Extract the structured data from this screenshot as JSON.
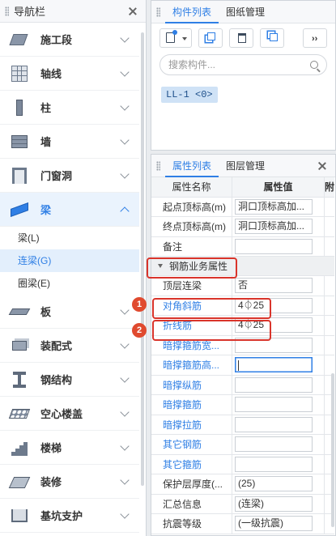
{
  "nav": {
    "title": "导航栏",
    "items": [
      {
        "label": "施工段",
        "icon": "construction-segment-icon"
      },
      {
        "label": "轴线",
        "icon": "axis-grid-icon"
      },
      {
        "label": "柱",
        "icon": "column-icon"
      },
      {
        "label": "墙",
        "icon": "wall-icon"
      },
      {
        "label": "门窗洞",
        "icon": "door-window-icon"
      },
      {
        "label": "梁",
        "icon": "beam-icon",
        "expanded": true
      },
      {
        "label": "板",
        "icon": "slab-icon"
      },
      {
        "label": "装配式",
        "icon": "prefab-icon"
      },
      {
        "label": "钢结构",
        "icon": "steel-structure-icon"
      },
      {
        "label": "空心楼盖",
        "icon": "hollow-floor-icon"
      },
      {
        "label": "楼梯",
        "icon": "stair-icon"
      },
      {
        "label": "装修",
        "icon": "decoration-icon"
      },
      {
        "label": "基坑支护",
        "icon": "foundation-pit-icon"
      }
    ],
    "beam_sub": [
      "梁(L)",
      "连梁(G)",
      "圈梁(E)"
    ],
    "beam_sub_selected": "连梁(G)"
  },
  "component_panel": {
    "tabs": [
      "构件列表",
      "图纸管理"
    ],
    "active_tab": "构件列表",
    "search_placeholder": "搜索构件...",
    "item": "LL-1 <0>"
  },
  "property_panel": {
    "tabs": [
      "属性列表",
      "图层管理"
    ],
    "active_tab": "属性列表",
    "col_name": "属性名称",
    "col_value": "属性值",
    "col_extra": "附",
    "rows_top": [
      {
        "name": "起点顶标高(m)",
        "value": "洞口顶标高加..."
      },
      {
        "name": "终点顶标高(m)",
        "value": "洞口顶标高加..."
      },
      {
        "name": "备注",
        "value": ""
      }
    ],
    "group": "钢筋业务属性",
    "rows_rebar": [
      {
        "name": "顶层连梁",
        "value": "否",
        "blue": false
      },
      {
        "name": "对角斜筋",
        "value": "4⏀25",
        "blue": true
      },
      {
        "name": "折线筋",
        "value": "4⏀25",
        "blue": true
      },
      {
        "name": "暗撑箍筋宽...",
        "value": "",
        "blue": true
      },
      {
        "name": "暗撑箍筋高...",
        "value": "",
        "blue": true,
        "focused": true
      },
      {
        "name": "暗撑纵筋",
        "value": "",
        "blue": true
      },
      {
        "name": "暗撑箍筋",
        "value": "",
        "blue": true
      },
      {
        "name": "暗撑拉筋",
        "value": "",
        "blue": true
      },
      {
        "name": "其它钢筋",
        "value": "",
        "blue": true
      },
      {
        "name": "其它箍筋",
        "value": "",
        "blue": true
      },
      {
        "name": "保护层厚度(...",
        "value": "(25)",
        "blue": false
      },
      {
        "name": "汇总信息",
        "value": "(连梁)",
        "blue": false
      },
      {
        "name": "抗震等级",
        "value": "(一级抗震)",
        "blue": false
      }
    ],
    "badges": [
      "1",
      "2"
    ]
  },
  "colors": {
    "accent": "#2f7fe5",
    "highlight": "#d9342b",
    "badge": "#e04a2f"
  }
}
